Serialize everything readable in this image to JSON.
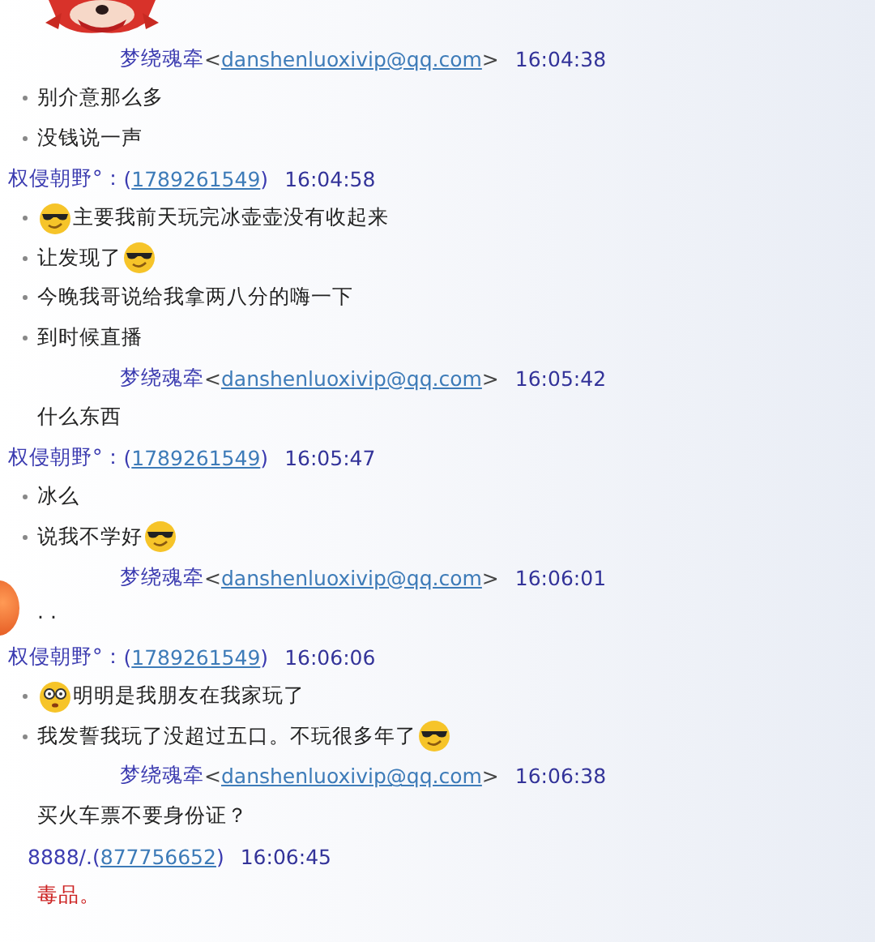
{
  "messages": [
    {
      "kind": "header_email",
      "name": "梦绕魂牵",
      "open": "<",
      "contact": "danshenluoxivip@qq.com",
      "close": ">",
      "time": "16:04:38"
    },
    {
      "kind": "bullet",
      "parts": [
        {
          "kind": "text",
          "text": "别介意那么多"
        }
      ]
    },
    {
      "kind": "bullet",
      "parts": [
        {
          "kind": "text",
          "text": "没钱说一声"
        }
      ]
    },
    {
      "kind": "header_number",
      "name": "权侵朝野°：",
      "open": "(",
      "contact": "1789261549",
      "close": ")",
      "time": "16:04:58"
    },
    {
      "kind": "bullet",
      "parts": [
        {
          "kind": "cool_emoji"
        },
        {
          "kind": "text",
          "text": "主要我前天玩完冰壶壶没有收起来"
        }
      ]
    },
    {
      "kind": "bullet",
      "parts": [
        {
          "kind": "text",
          "text": "让发现了"
        },
        {
          "kind": "cool_emoji"
        }
      ]
    },
    {
      "kind": "bullet",
      "parts": [
        {
          "kind": "text",
          "text": "今晚我哥说给我拿两八分的嗨一下"
        }
      ]
    },
    {
      "kind": "bullet",
      "parts": [
        {
          "kind": "text",
          "text": "到时候直播"
        }
      ]
    },
    {
      "kind": "header_email",
      "name": "梦绕魂牵",
      "open": "<",
      "contact": "danshenluoxivip@qq.com",
      "close": ">",
      "time": "16:05:42"
    },
    {
      "kind": "plain",
      "parts": [
        {
          "kind": "text",
          "text": "什么东西"
        }
      ]
    },
    {
      "kind": "header_number",
      "name": "权侵朝野°：",
      "open": "(",
      "contact": "1789261549",
      "close": ")",
      "time": "16:05:47"
    },
    {
      "kind": "bullet",
      "parts": [
        {
          "kind": "text",
          "text": "冰么"
        }
      ]
    },
    {
      "kind": "bullet",
      "parts": [
        {
          "kind": "text",
          "text": "说我不学好"
        },
        {
          "kind": "cool_emoji"
        }
      ]
    },
    {
      "kind": "header_email",
      "name": "梦绕魂牵",
      "open": "<",
      "contact": "danshenluoxivip@qq.com",
      "close": ">",
      "time": "16:06:01"
    },
    {
      "kind": "plain",
      "parts": [
        {
          "kind": "text",
          "text": "· ·"
        }
      ]
    },
    {
      "kind": "header_number",
      "name": "权侵朝野°：",
      "open": "(",
      "contact": "1789261549",
      "close": ")",
      "time": "16:06:06"
    },
    {
      "kind": "bullet",
      "parts": [
        {
          "kind": "dizzy_emoji"
        },
        {
          "kind": "text",
          "text": "明明是我朋友在我家玩了"
        }
      ]
    },
    {
      "kind": "bullet",
      "parts": [
        {
          "kind": "text",
          "text": "我发誓我玩了没超过五口。不玩很多年了"
        },
        {
          "kind": "cool_emoji"
        }
      ]
    },
    {
      "kind": "header_email",
      "name": "梦绕魂牵",
      "open": "<",
      "contact": "danshenluoxivip@qq.com",
      "close": ">",
      "time": "16:06:38"
    },
    {
      "kind": "plain",
      "parts": [
        {
          "kind": "text",
          "text": "买火车票不要身份证？"
        }
      ]
    },
    {
      "kind": "header_number_inset",
      "name": "8888/.",
      "open": "(",
      "contact": "877756652",
      "close": ")",
      "time": "16:06:45"
    },
    {
      "kind": "plain",
      "parts": [
        {
          "kind": "text",
          "text": "毒品。",
          "color": "#cc2222"
        }
      ]
    }
  ]
}
